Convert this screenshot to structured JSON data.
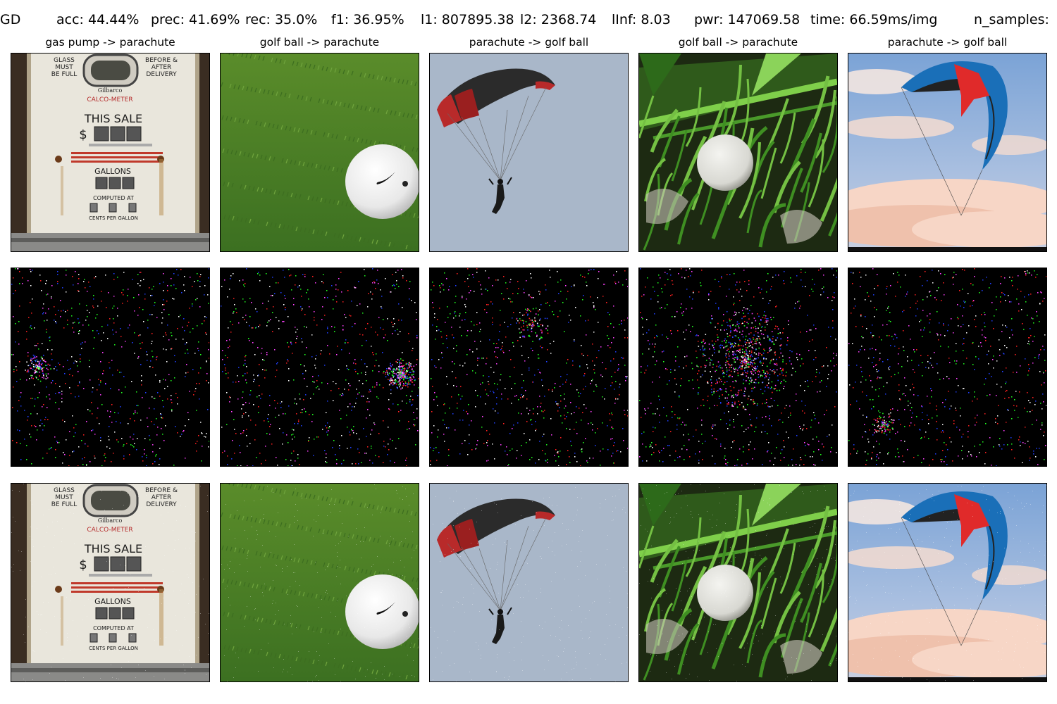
{
  "header": {
    "method": "GD",
    "acc": "acc: 44.44%",
    "prec": "prec: 41.69%",
    "rec": "rec: 35.0%",
    "f1": "f1: 36.95%",
    "l1": "l1: 807895.38",
    "l2": "l2: 2368.74",
    "linf": "lInf: 8.03",
    "pwr": "pwr: 147069.58",
    "time": "time: 66.59ms/img",
    "n_samples": "n_samples:"
  },
  "columns": [
    {
      "title": "gas pump -> parachute",
      "subject": "gas-pump"
    },
    {
      "title": "golf ball -> parachute",
      "subject": "golf-ball-on-grass"
    },
    {
      "title": "parachute -> golf ball",
      "subject": "parachute"
    },
    {
      "title": "golf ball -> parachute",
      "subject": "golf-ball-in-weeds"
    },
    {
      "title": "parachute -> golf ball",
      "subject": "kite-parachute"
    }
  ],
  "gaspump": {
    "tl": [
      "GLASS",
      "MUST",
      "BE FULL"
    ],
    "tr": [
      "BEFORE &",
      "AFTER",
      "DELIVERY"
    ],
    "brand": "Gilbarco",
    "brand2": "CALCO-METER",
    "sale": "THIS  SALE",
    "dollar": "$",
    "gallons": "GALLONS",
    "computed": "COMPUTED AT",
    "cents": "CENTS PER GALLON"
  },
  "colors": {
    "noise_red": "#ff2020",
    "noise_green": "#20ff20",
    "noise_blue": "#2040ff",
    "noise_white": "#ffffff",
    "noise_magenta": "#ff40ff",
    "sky": "#a9b7c9",
    "grass": "#4f8a2c"
  }
}
